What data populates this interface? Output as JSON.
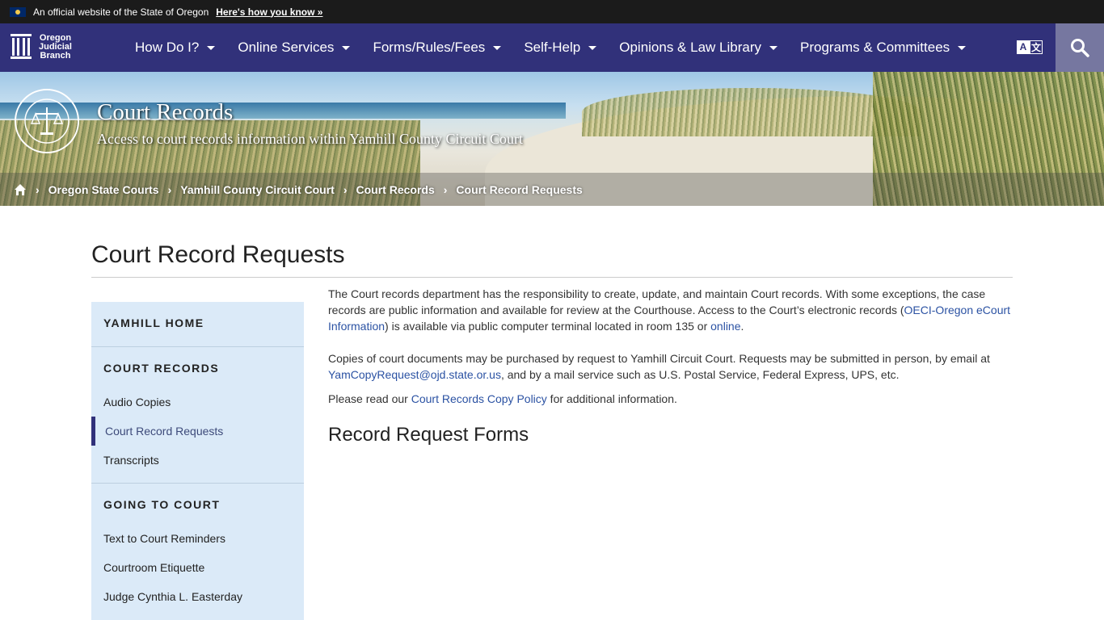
{
  "official_bar": {
    "text": "An official website of the State of Oregon",
    "how_link": "Here's how you know »"
  },
  "logo": {
    "line1": "Oregon",
    "line2": "Judicial",
    "line3": "Branch"
  },
  "nav": {
    "items": [
      {
        "label": "How Do I?"
      },
      {
        "label": "Online Services"
      },
      {
        "label": "Forms/Rules/Fees"
      },
      {
        "label": "Self-Help"
      },
      {
        "label": "Opinions & Law Library"
      },
      {
        "label": "Programs & Committees"
      }
    ],
    "translate_icon": "translate-icon",
    "search_icon": "search-icon"
  },
  "banner": {
    "title": "Court Records",
    "subtitle": "Access to court records information within Yamhill County Circuit Court"
  },
  "breadcrumb": {
    "items": [
      "Oregon State Courts",
      "Yamhill County Circuit Court",
      "Court Records",
      "Court Record Requests"
    ]
  },
  "page": {
    "title": "Court Record Requests"
  },
  "sidebar": {
    "sections": [
      {
        "heading": "YAMHILL HOME",
        "links": []
      },
      {
        "heading": "COURT RECORDS",
        "links": [
          "Audio Copies",
          "Court Record Requests",
          "Transcripts"
        ]
      },
      {
        "heading": "GOING TO COURT",
        "links": [
          "Text to Court Reminders",
          "Courtroom Etiquette",
          "Judge Cynthia L. Easterday"
        ]
      }
    ],
    "active": "Court Record Requests"
  },
  "content": {
    "p1_a": " The Court records department has the responsibility to create, update, and maintain Court records. With some exceptions, the case records are public information and available for review at the Courthouse. Access to the Court’s electronic records (",
    "p1_link": "OECI-Oregon eCourt Information",
    "p1_b": ") is available via public computer terminal located in room 135 or ",
    "p1_link2": "online",
    "p1_c": ".",
    "p2_a": "Copies of court documents may be purchased by request to Yamhill Circuit Court. Requests may be submitted in person, by email at ",
    "p2_link": "YamCopyRequest@ojd.state.or.us",
    "p2_b": ", and by a mail service such as U.S. Postal Service, Federal Express, UPS, etc.",
    "p3_a": " Please read our ",
    "p3_link": "Court Records Copy Policy",
    "p3_b": " for additional information.",
    "h2": "Record Request Forms"
  },
  "colors": {
    "nav_bg": "#31317a",
    "link": "#2b52a3",
    "sidebar_bg": "#dbeaf8"
  }
}
